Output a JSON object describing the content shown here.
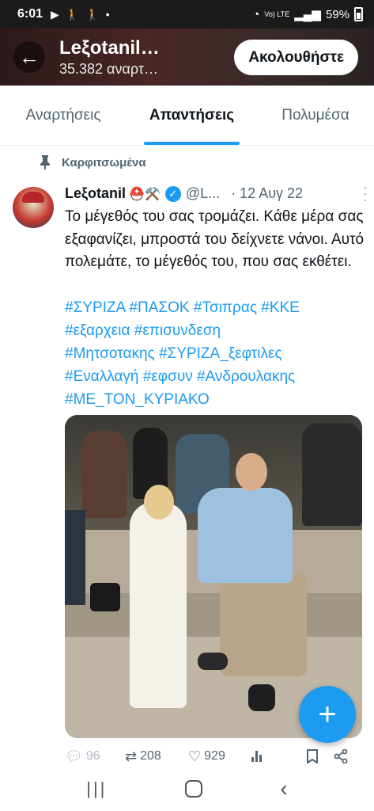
{
  "status_bar": {
    "time": "6:01",
    "battery": "59%",
    "network": "Vo) LTE"
  },
  "header": {
    "back_icon": "arrow-left-icon",
    "name": "Leξotanil…",
    "subtitle": "35.382 αναρτ…",
    "follow_label": "Ακολουθήστε"
  },
  "tabs": [
    {
      "label": "Αναρτήσεις",
      "active": false
    },
    {
      "label": "Απαντήσεις",
      "active": true
    },
    {
      "label": "Πολυμέσα",
      "active": false
    }
  ],
  "pinned_label": "Καρφιτσωμένα",
  "tweet": {
    "name": "Leξotanil",
    "name_emoji": "⛑️⚒️",
    "handle": "@L...",
    "date": "· 12 Αυγ 22",
    "text": "Το μέγεθός του σας τρομάζει. Κάθε μέρα σας εξαφανίζει, μπροστά του δείχνετε νάνοι. Αυτό πολεμάτε, το μέγεθός του, που σας εκθέτει.",
    "hashtags_line1": "#ΣΥΡΙΖΑ #ΠΑΣΟΚ #Τσιπρας #ΚΚΕ",
    "hashtags_line2": "#εξαρχεια #επισυνδεση",
    "hashtags_line3": "#Μητσοτακης #ΣΥΡΙΖΑ_ξεφτιλες",
    "hashtags_line4": "#Εναλλαγή #εφσυν #Ανδρουλακης",
    "hashtags_line5": "#ΜΕ_ΤΟΝ_ΚΥΡΙΑΚΟ",
    "replies": "96",
    "retweets": "208",
    "likes": "929"
  },
  "colors": {
    "accent": "#1d9bf0",
    "text": "#0f1419",
    "muted": "#536471"
  }
}
